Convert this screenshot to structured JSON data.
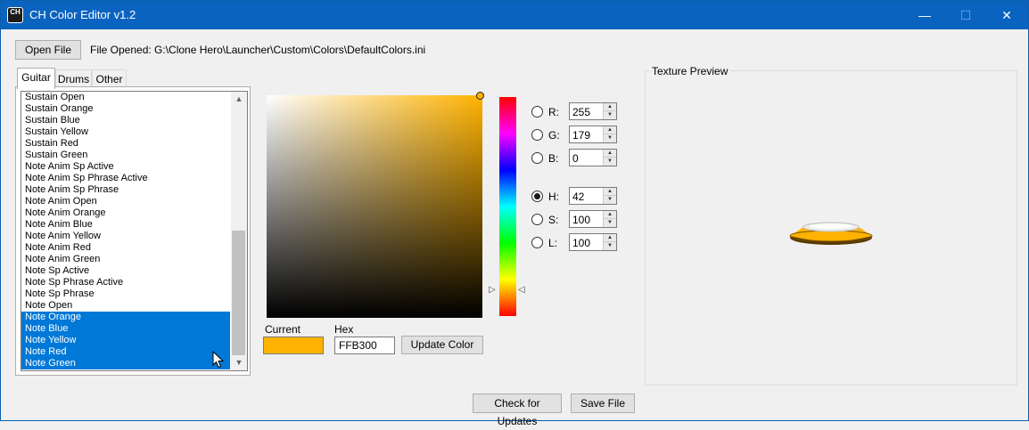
{
  "window": {
    "title": "CH Color Editor v1.2",
    "icon_text": "CH",
    "min_glyph": "—",
    "max_glyph": "☐",
    "close_glyph": "✕"
  },
  "toolbar": {
    "open_label": "Open File",
    "file_opened": "File Opened: G:\\Clone Hero\\Launcher\\Custom\\Colors\\DefaultColors.ini"
  },
  "tabs": [
    {
      "label": "Guitar",
      "active": true
    },
    {
      "label": "Drums",
      "active": false
    },
    {
      "label": "Other",
      "active": false
    }
  ],
  "list": {
    "items": [
      {
        "label": "Sustain Open",
        "selected": false
      },
      {
        "label": "Sustain Orange",
        "selected": false
      },
      {
        "label": "Sustain Blue",
        "selected": false
      },
      {
        "label": "Sustain Yellow",
        "selected": false
      },
      {
        "label": "Sustain Red",
        "selected": false
      },
      {
        "label": "Sustain Green",
        "selected": false
      },
      {
        "label": "Note Anim Sp Active",
        "selected": false
      },
      {
        "label": "Note Anim Sp Phrase Active",
        "selected": false
      },
      {
        "label": "Note Anim Sp Phrase",
        "selected": false
      },
      {
        "label": "Note Anim Open",
        "selected": false
      },
      {
        "label": "Note Anim Orange",
        "selected": false
      },
      {
        "label": "Note Anim Blue",
        "selected": false
      },
      {
        "label": "Note Anim Yellow",
        "selected": false
      },
      {
        "label": "Note Anim Red",
        "selected": false
      },
      {
        "label": "Note Anim Green",
        "selected": false
      },
      {
        "label": "Note Sp Active",
        "selected": false
      },
      {
        "label": "Note Sp Phrase Active",
        "selected": false
      },
      {
        "label": "Note Sp Phrase",
        "selected": false
      },
      {
        "label": "Note Open",
        "selected": false
      },
      {
        "label": "Note Orange",
        "selected": true
      },
      {
        "label": "Note Blue",
        "selected": true
      },
      {
        "label": "Note Yellow",
        "selected": true
      },
      {
        "label": "Note Red",
        "selected": true
      },
      {
        "label": "Note Green",
        "selected": true
      }
    ],
    "scroll_up": "▲",
    "scroll_down": "▼"
  },
  "picker": {
    "hue_arrow_left": "▷",
    "hue_arrow_right": "◁",
    "current_label": "Current",
    "hex_label": "Hex",
    "hex_value": "FFB300",
    "update_label": "Update Color",
    "current_color": "#ffb300"
  },
  "channels": {
    "r": {
      "label": "R:",
      "value": "255",
      "checked": false
    },
    "g": {
      "label": "G:",
      "value": "179",
      "checked": false
    },
    "b": {
      "label": "B:",
      "value": "0",
      "checked": false
    },
    "h": {
      "label": "H:",
      "value": "42",
      "checked": true
    },
    "s": {
      "label": "S:",
      "value": "100",
      "checked": false
    },
    "l": {
      "label": "L:",
      "value": "100",
      "checked": false
    }
  },
  "preview": {
    "title": "Texture Preview"
  },
  "footer": {
    "check_updates_label": "Check for Updates",
    "save_label": "Save File"
  }
}
